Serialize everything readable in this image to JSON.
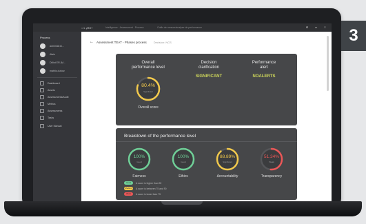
{
  "step": {
    "number": "3"
  },
  "topbar": {
    "brand": "○ Ł ₑRO+",
    "crumbs": "Intelligence · Assessment · Process",
    "title": "Outils de mesure/analyse de performance"
  },
  "sidebar": {
    "header": "Process",
    "users": [
      {
        "label": "administrat..."
      },
      {
        "label": "Alain"
      },
      {
        "label": "Dilliot ER (M..."
      },
      {
        "label": "mathis.dufour"
      }
    ],
    "items": [
      {
        "label": "Dashboard",
        "icon": "grid-icon"
      },
      {
        "label": "Assets",
        "icon": "box-icon"
      },
      {
        "label": "Assessments/Audit",
        "icon": "check-icon"
      },
      {
        "label": "Metrics",
        "icon": "chart-icon"
      },
      {
        "label": "Assessments",
        "icon": "list-icon"
      },
      {
        "label": "Tasks",
        "icon": "task-icon"
      },
      {
        "label": "User Manual",
        "icon": "book-icon"
      }
    ]
  },
  "header": {
    "title": "Assessment TEAT - Phases process",
    "subtitle": "Decision: NCS"
  },
  "overview": {
    "overall_title": "Overall\nperformance level",
    "overall_pct": "80.4%",
    "overall_sub": "Significant",
    "overall_caption": "Overall score",
    "decision_title": "Decision\nclarification",
    "decision_value": "SIGNIFICANT",
    "alert_title": "Performance\nalert",
    "alert_value": "NOALERTS",
    "colors": {
      "good": "#f2c94c",
      "green": "#6fcf97",
      "red": "#eb5757",
      "accent": "#d7df4e"
    }
  },
  "breakdown": {
    "title": "Breakdown of the performance level",
    "gauges": [
      {
        "label": "Fairness",
        "pct": "100%",
        "sub": "Good",
        "value": 1.0,
        "color": "#6fcf97"
      },
      {
        "label": "Ethics",
        "pct": "100%",
        "sub": "Good",
        "value": 1.0,
        "color": "#6fcf97"
      },
      {
        "label": "Accountability",
        "pct": "88.89%",
        "sub": "Significant",
        "value": 0.8889,
        "color": "#f2c94c"
      },
      {
        "label": "Transparency",
        "pct": "51.34%",
        "sub": "Weak",
        "value": 0.5134,
        "color": "#eb5757"
      }
    ],
    "legend": [
      {
        "pill": "Good",
        "text": "A score is higher than 90",
        "color": "#6fcf97"
      },
      {
        "pill": "Medium",
        "text": "A score is between 75 and 90",
        "color": "#f2c94c"
      },
      {
        "pill": "Weak",
        "text": "A score is lower than 75",
        "color": "#eb5757"
      }
    ]
  }
}
